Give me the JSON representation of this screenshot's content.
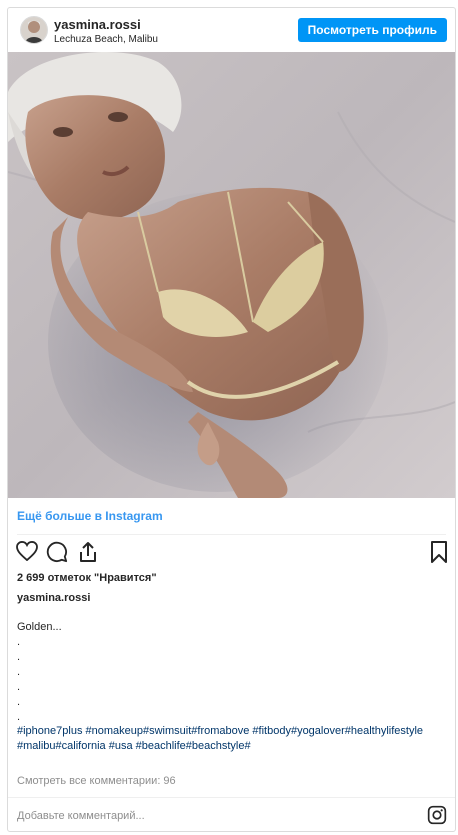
{
  "header": {
    "username": "yasmina.rossi",
    "location": "Lechuza Beach, Malibu",
    "profile_button": "Посмотреть профиль"
  },
  "post": {
    "more_link": "Ещё больше в Instagram",
    "likes": "2 699 отметок \"Нравится\"",
    "author": "yasmina.rossi",
    "caption": "Golden...\n.\n.\n.\n.\n.\n.",
    "hashtags": "#iphone7plus #nomakeup#swimsuit#fromabove #fitbody#yogalover#healthylifestyle #malibu#california #usa #beachlife#beachstyle#",
    "comments_link": "Смотреть все комментарии: 96",
    "add_comment_placeholder": "Добавьте комментарий..."
  },
  "icons": {
    "like": "heart-icon",
    "comment": "comment-icon",
    "share": "share-icon",
    "save": "bookmark-icon",
    "instagram": "instagram-icon"
  },
  "colors": {
    "accent": "#0095f6",
    "link": "#3897f0",
    "hashtag": "#003569",
    "muted": "#8e8e8e"
  }
}
